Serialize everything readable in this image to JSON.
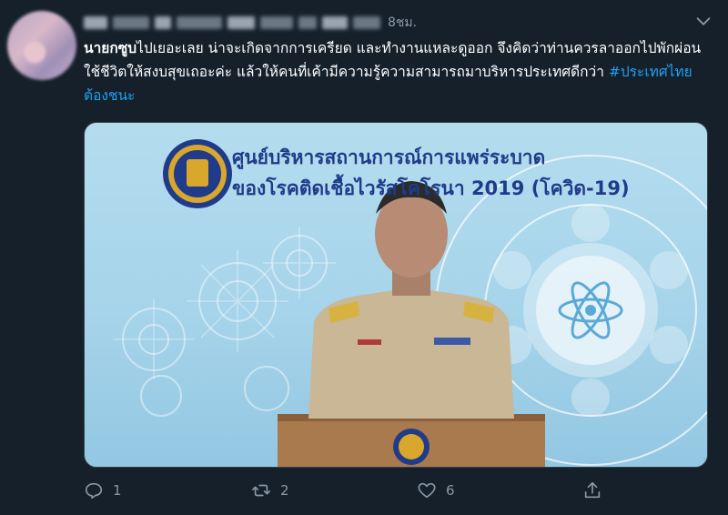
{
  "tweet": {
    "time": "8ชม.",
    "text_bold": "นายกซูบ",
    "text_body": "ไปเยอะเลย น่าจะเกิดจากการเครียด และทำงานแหละดูออก จึงคิดว่าท่านควรลาออกไปพักผ่อน ใช้ชีวิตให้สงบสุขเถอะค่ะ แล้วให้คนที่เค้ามีความรู้ความสามารถมาบริหารประเทศดีกว่า ",
    "hashtag": "#ประเทศไทยต้องชนะ"
  },
  "media": {
    "banner_line1": "ศูนย์บริหารสถานการณ์การแพร่ระบาด",
    "banner_line2": "ของโรคติดเชื้อไวรัสโคโรนา 2019 (โควิด-19)"
  },
  "actions": {
    "reply_count": "1",
    "retweet_count": "2",
    "like_count": "6"
  },
  "colors": {
    "background": "#15202b",
    "text": "#ffffff",
    "secondary": "#8899a6",
    "link": "#1da1f2",
    "banner_text": "#1f3b8a"
  },
  "icons": [
    "chevron-down-icon",
    "reply-icon",
    "retweet-icon",
    "like-icon",
    "share-icon"
  ]
}
